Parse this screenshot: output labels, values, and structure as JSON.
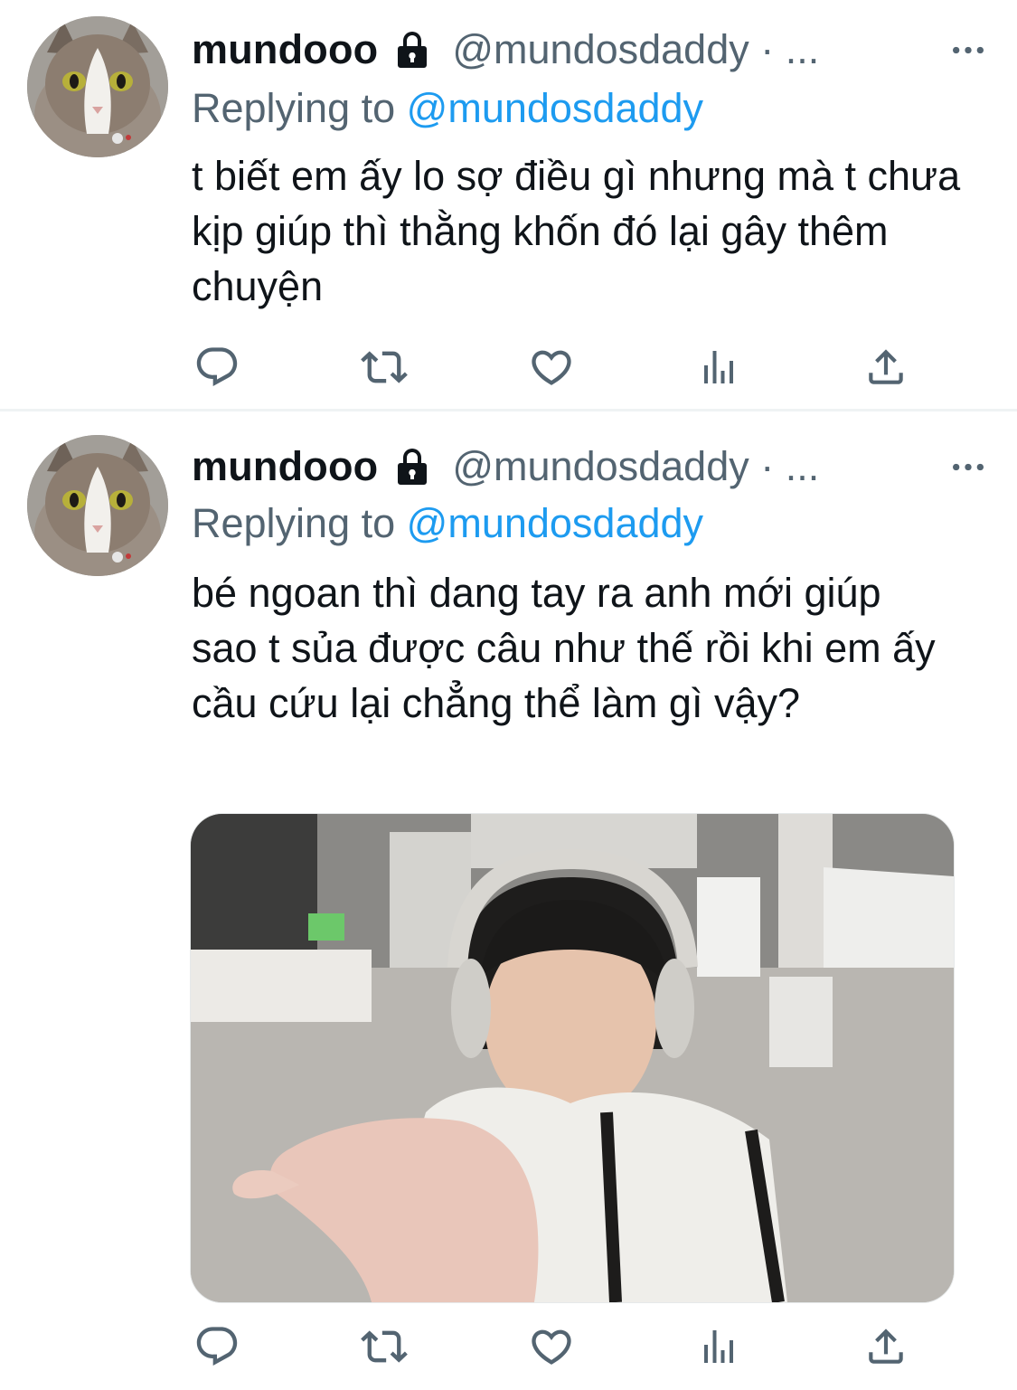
{
  "tweets": [
    {
      "display_name": "mundooo",
      "handle": "@mundosdaddy",
      "separator": "· ...",
      "replying_prefix": "Replying to",
      "replying_to": "@mundosdaddy",
      "text": "t biết em ấy lo sợ điều gì nhưng mà t chưa kịp giúp thì thằng khốn đó lại gây thêm chuyện",
      "icons": [
        "lock-icon",
        "more-icon",
        "reply-icon",
        "retweet-icon",
        "like-icon",
        "views-icon",
        "share-icon"
      ]
    },
    {
      "display_name": "mundooo",
      "handle": "@mundosdaddy",
      "separator": "· ...",
      "replying_prefix": "Replying to",
      "replying_to": "@mundosdaddy",
      "text": "bé ngoan thì dang tay ra anh mới giúp\nsao t sủa được câu như thế rồi khi em ấy cầu cứu lại chẳng thể làm gì vậy?",
      "has_media": true,
      "icons": [
        "lock-icon",
        "more-icon",
        "reply-icon",
        "retweet-icon",
        "like-icon",
        "views-icon",
        "share-icon"
      ]
    }
  ],
  "colors": {
    "text": "#0f1419",
    "secondary": "#536471",
    "mention": "#1d9bf0",
    "divider": "#eff3f4",
    "background": "#ffffff"
  }
}
